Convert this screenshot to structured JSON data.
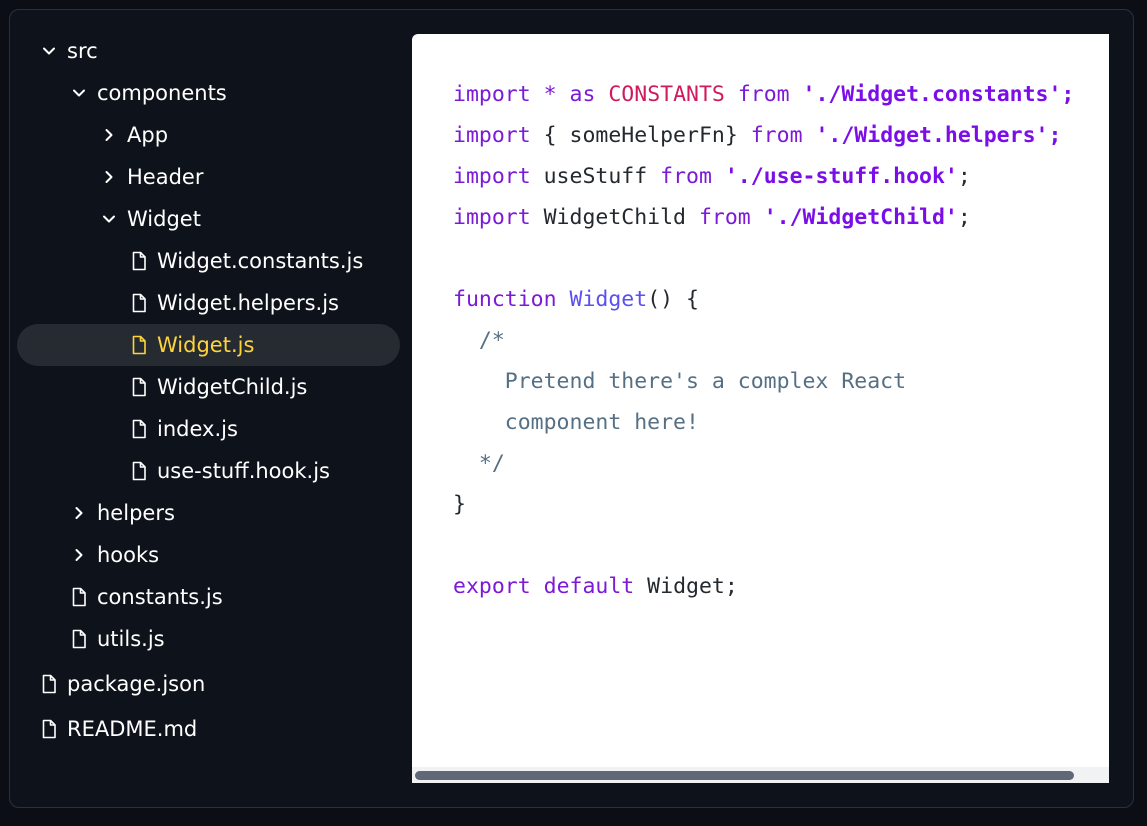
{
  "tree": [
    {
      "label": "src",
      "type": "folder",
      "expanded": true
    },
    {
      "label": "components",
      "type": "folder",
      "expanded": true
    },
    {
      "label": "App",
      "type": "folder",
      "expanded": false
    },
    {
      "label": "Header",
      "type": "folder",
      "expanded": false
    },
    {
      "label": "Widget",
      "type": "folder",
      "expanded": true
    },
    {
      "label": "Widget.constants.js",
      "type": "file"
    },
    {
      "label": "Widget.helpers.js",
      "type": "file"
    },
    {
      "label": "Widget.js",
      "type": "file",
      "selected": true
    },
    {
      "label": "WidgetChild.js",
      "type": "file"
    },
    {
      "label": "index.js",
      "type": "file"
    },
    {
      "label": "use-stuff.hook.js",
      "type": "file"
    },
    {
      "label": "helpers",
      "type": "folder",
      "expanded": false
    },
    {
      "label": "hooks",
      "type": "folder",
      "expanded": false
    },
    {
      "label": "constants.js",
      "type": "file"
    },
    {
      "label": "utils.js",
      "type": "file"
    },
    {
      "label": "package.json",
      "type": "file"
    },
    {
      "label": "README.md",
      "type": "file"
    }
  ],
  "code": {
    "lines": [
      [
        {
          "t": "import",
          "c": "kw"
        },
        {
          "t": " * ",
          "c": "kw"
        },
        {
          "t": "as",
          "c": "kw"
        },
        {
          "t": " "
        },
        {
          "t": "CONSTANTS",
          "c": "const"
        },
        {
          "t": " "
        },
        {
          "t": "from",
          "c": "kw"
        },
        {
          "t": " "
        },
        {
          "t": "'./Widget.constants';",
          "c": "str"
        }
      ],
      [
        {
          "t": "import",
          "c": "kw"
        },
        {
          "t": " { someHelperFn} "
        },
        {
          "t": "from",
          "c": "kw"
        },
        {
          "t": " "
        },
        {
          "t": "'./Widget.helpers';",
          "c": "str"
        }
      ],
      [
        {
          "t": "import",
          "c": "kw"
        },
        {
          "t": " useStuff "
        },
        {
          "t": "from",
          "c": "kw"
        },
        {
          "t": " "
        },
        {
          "t": "'./use-stuff.hook'",
          "c": "str"
        },
        {
          "t": ";"
        }
      ],
      [
        {
          "t": "import",
          "c": "kw"
        },
        {
          "t": " WidgetChild "
        },
        {
          "t": "from",
          "c": "kw"
        },
        {
          "t": " "
        },
        {
          "t": "'./WidgetChild'",
          "c": "str"
        },
        {
          "t": ";"
        }
      ],
      [],
      [
        {
          "t": "function",
          "c": "kw"
        },
        {
          "t": " "
        },
        {
          "t": "Widget",
          "c": "fn"
        },
        {
          "t": "() {"
        }
      ],
      [
        {
          "t": "  /*",
          "c": "cm"
        }
      ],
      [
        {
          "t": "    Pretend there's a complex React",
          "c": "cm"
        }
      ],
      [
        {
          "t": "    component here!",
          "c": "cm"
        }
      ],
      [
        {
          "t": "  */",
          "c": "cm"
        }
      ],
      [
        {
          "t": "}"
        }
      ],
      [],
      [
        {
          "t": "export",
          "c": "kw"
        },
        {
          "t": " "
        },
        {
          "t": "default",
          "c": "kw"
        },
        {
          "t": " Widget;"
        }
      ]
    ]
  },
  "colors": {
    "selected_text": "#ffd43b",
    "keyword": "#7c1ad7",
    "string": "#7b0ee8",
    "constant": "#d01a5e",
    "function_name": "#5a4ff0",
    "comment": "#557085"
  }
}
